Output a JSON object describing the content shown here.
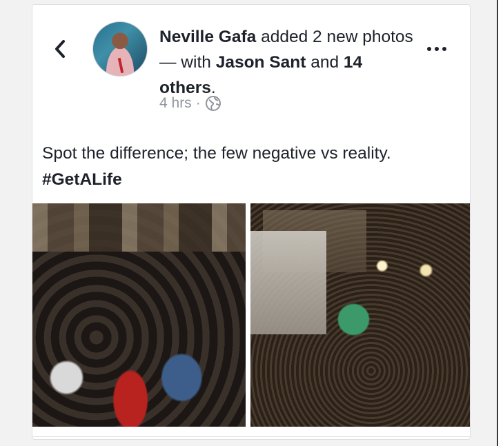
{
  "post": {
    "author": "Neville Gafa",
    "action_1": " added 2 new photos — with ",
    "tagged_1": "Jason Sant",
    "action_2": " and ",
    "tagged_2": "14 others",
    "action_end": ".",
    "time": "4 hrs",
    "separator": "·",
    "privacy_icon": "globe-icon",
    "text": "Spot the  difference; the few negative vs reality. ",
    "hashtag": "#GetALife"
  },
  "nav": {
    "back_icon": "chevron-left-icon",
    "more_icon": "more-horizontal-icon"
  },
  "photos": [
    {
      "name": "photo-1"
    },
    {
      "name": "photo-2"
    }
  ],
  "colors": {
    "text": "#1d2129",
    "meta": "#90949c",
    "card_border": "#dddfe2"
  }
}
